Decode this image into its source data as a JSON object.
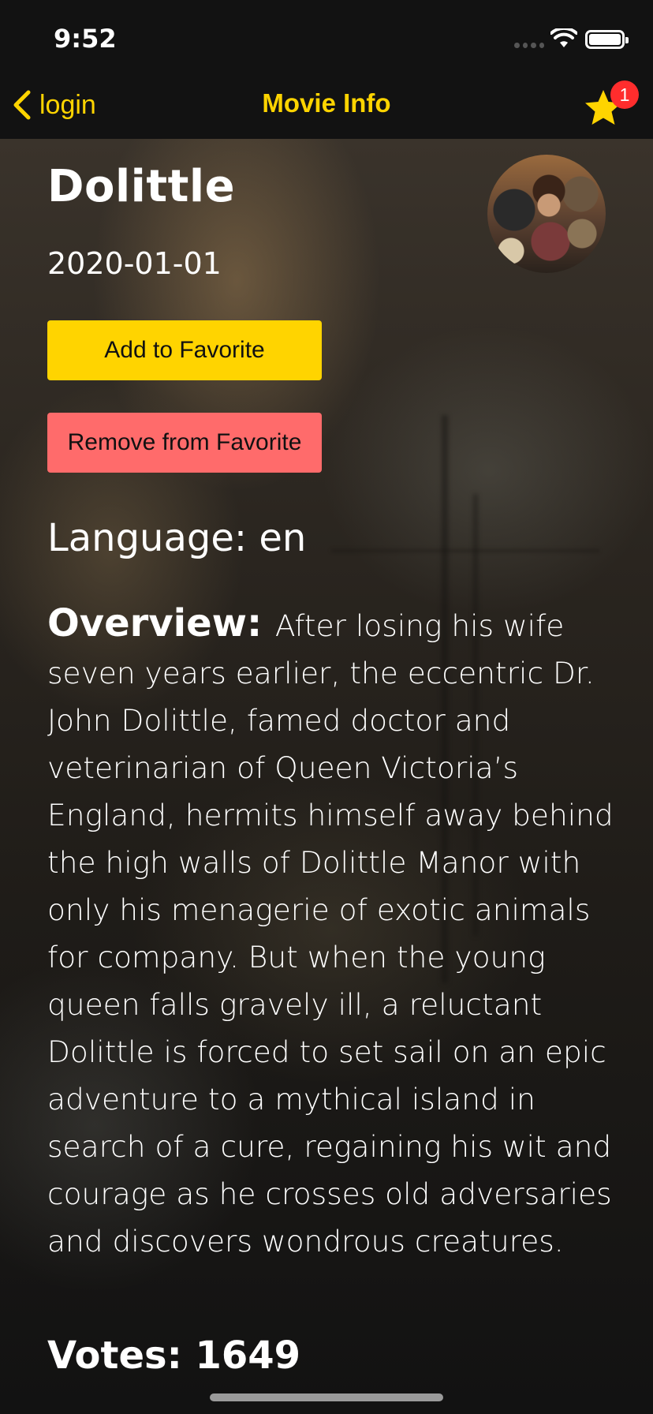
{
  "status_bar": {
    "time": "9:52"
  },
  "nav": {
    "back_label": "login",
    "title": "Movie Info",
    "favorites_badge": "1",
    "accent_color": "#ffd400",
    "badge_color": "#ff2d2d"
  },
  "movie": {
    "title": "Dolittle",
    "release_date": "2020-01-01",
    "language_label": "Language: en",
    "overview_label": "Overview:",
    "overview_text": "After losing his wife seven years earlier, the eccentric Dr. John Dolittle, famed doctor and veterinarian of Queen Victoria’s England, hermits himself away behind the high walls of Dolittle Manor with only his menagerie of exotic animals for company. But when the young queen falls gravely ill, a reluctant Dolittle is forced to set sail on an epic adventure to a mythical island in search of a cure, regaining his wit and courage as he crosses old adversaries and discovers wondrous creatures.",
    "votes_label": "Votes: 1649"
  },
  "actions": {
    "add_label": "Add to Favorite",
    "remove_label": "Remove from Favorite",
    "add_color": "#ffd400",
    "remove_color": "#ff6b6b"
  },
  "icons": {
    "back": "chevron-left-icon",
    "favorites": "star-icon",
    "wifi": "wifi-icon",
    "battery": "battery-icon",
    "signal": "signal-icon"
  }
}
